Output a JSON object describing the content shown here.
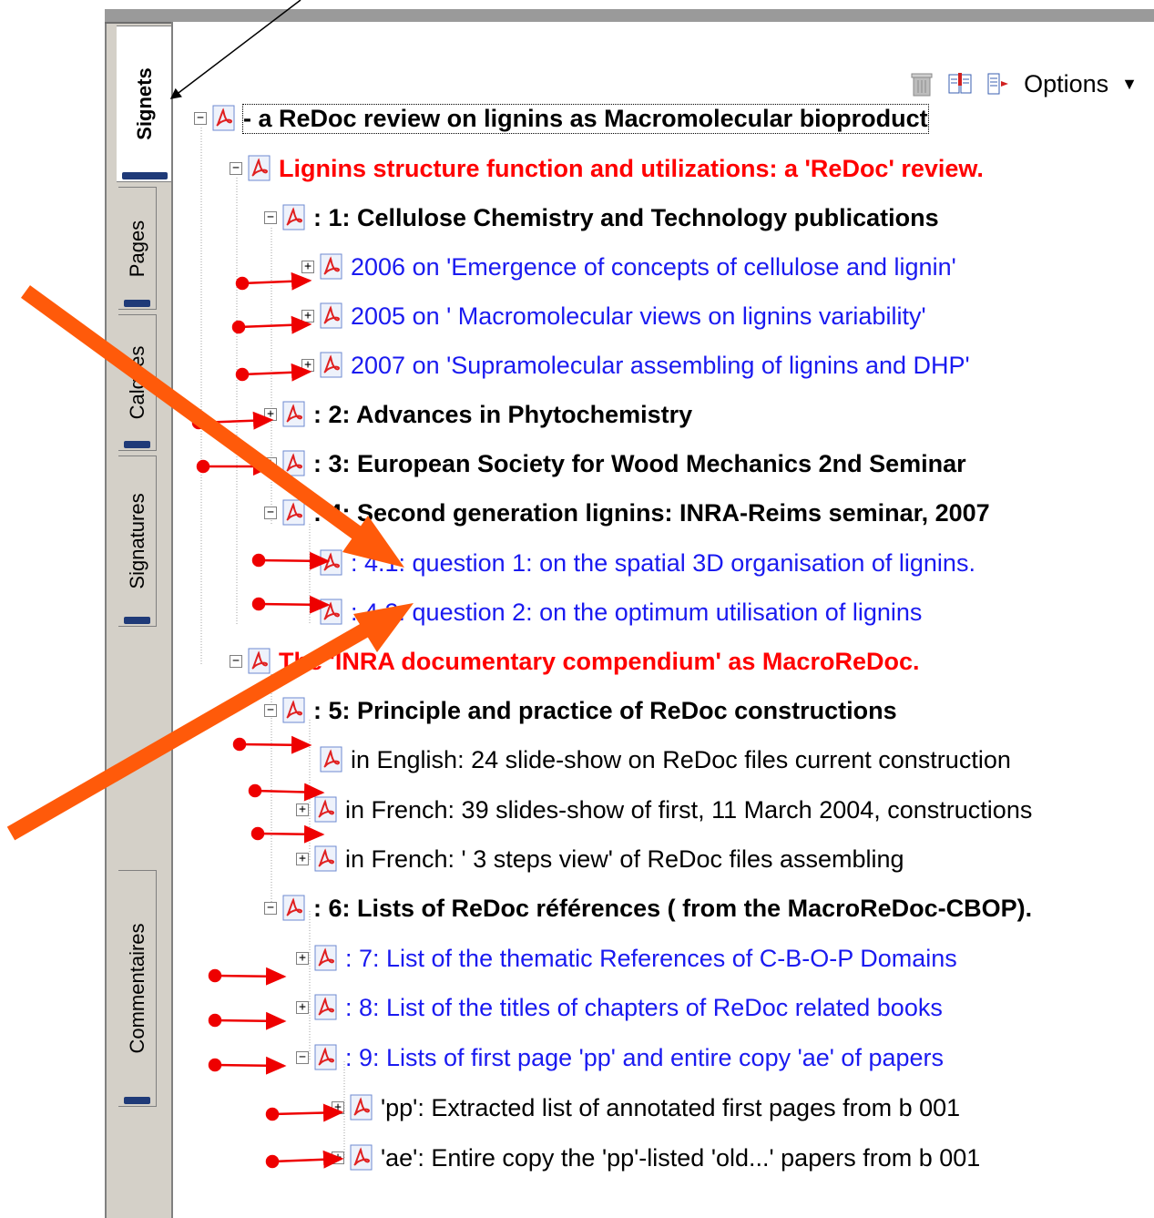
{
  "side_tabs": [
    {
      "label": "Signets"
    },
    {
      "label": "Pages"
    },
    {
      "label": "Calques"
    },
    {
      "label": "Signatures"
    },
    {
      "label": "Commentaires"
    }
  ],
  "toolbar": {
    "icons": [
      "trash-icon",
      "new-bookmark-icon",
      "move-bookmark-icon"
    ],
    "options_label": "Options"
  },
  "bookmarks": [
    {
      "text": "- a ReDoc review on lignins as Macromolecular bioproduct",
      "expander": "minus",
      "color": "#000000",
      "bold": true
    },
    {
      "text": "Lignins structure function and utilizations: a 'ReDoc' review.",
      "expander": "minus",
      "color": "#ff0000",
      "bold": true
    },
    {
      "text": ": 1: Cellulose Chemistry and Technology publications",
      "expander": "minus",
      "color": "#000000",
      "bold": true
    },
    {
      "text": "2006 on 'Emergence of concepts of cellulose and lignin'",
      "expander": "plus",
      "color": "#1a1af0",
      "bold": false
    },
    {
      "text": "2005 on ' Macromolecular views on lignins variability'",
      "expander": "plus",
      "color": "#1a1af0",
      "bold": false
    },
    {
      "text": "2007 on  'Supramolecular assembling of lignins and DHP'",
      "expander": "plus",
      "color": "#1a1af0",
      "bold": false
    },
    {
      "text": ": 2: Advances in Phytochemistry",
      "expander": "plus",
      "color": "#000000",
      "bold": true
    },
    {
      "text": ": 3: European Society for Wood Mechanics 2nd Seminar",
      "expander": "plus",
      "color": "#000000",
      "bold": true
    },
    {
      "text": ": 4: Second generation lignins: INRA-Reims seminar, 2007",
      "expander": "minus",
      "color": "#000000",
      "bold": true
    },
    {
      "text": ": 4.1: question 1: on the spatial 3D organisation of lignins.",
      "expander": "none",
      "color": "#1a1af0",
      "bold": false
    },
    {
      "text": ": 4.2: question 2: on the optimum utilisation of lignins",
      "expander": "none",
      "color": "#1a1af0",
      "bold": false
    },
    {
      "text": "The 'INRA documentary compendium' as MacroReDoc.",
      "expander": "minus",
      "color": "#ff0000",
      "bold": true
    },
    {
      "text": ": 5: Principle and practice of ReDoc constructions",
      "expander": "minus",
      "color": "#000000",
      "bold": true
    },
    {
      "text": " in English: 24 slide-show on ReDoc files current construction",
      "expander": "none",
      "color": "#000000",
      "bold": false
    },
    {
      "text": "in French: 39 slides-show of first, 11 March 2004, constructions",
      "expander": "plus",
      "color": "#000000",
      "bold": false
    },
    {
      "text": "in French: ' 3 steps view' of  ReDoc files assembling",
      "expander": "plus",
      "color": "#000000",
      "bold": false
    },
    {
      "text": ": 6: Lists of ReDoc références ( from the MacroReDoc-CBOP).",
      "expander": "minus",
      "color": "#000000",
      "bold": true
    },
    {
      "text": ": 7: List of the thematic References of C-B-O-P Domains",
      "expander": "plus",
      "color": "#1a1af0",
      "bold": false
    },
    {
      "text": ": 8:  List of the titles of chapters of ReDoc related books",
      "expander": "plus",
      "color": "#1a1af0",
      "bold": false
    },
    {
      "text": ": 9: Lists of  first page 'pp' and entire copy 'ae'  of papers",
      "expander": "minus",
      "color": "#1a1af0",
      "bold": false
    },
    {
      "text": " 'pp': Extracted  list of annotated first pages from b 001",
      "expander": "plus",
      "color": "#000000",
      "bold": false
    },
    {
      "text": "'ae': Entire copy the 'pp'-listed 'old...' papers from b 001",
      "expander": "plus",
      "color": "#000000",
      "bold": false
    }
  ],
  "annotation_colors": {
    "small_arrows": "#ee0000",
    "big_arrows": "#ff5a0a",
    "pointer_line": "#000000"
  }
}
